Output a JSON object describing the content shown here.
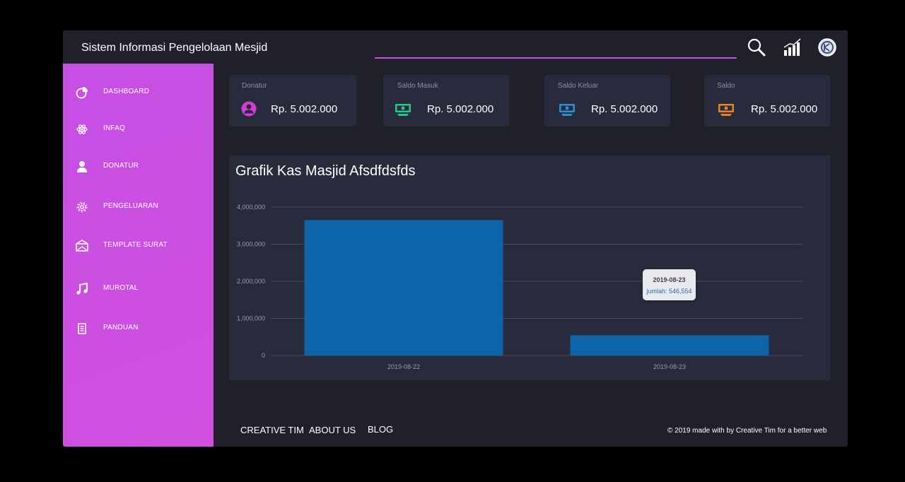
{
  "app": {
    "title": "Sistem Informasi Pengelolaan Mesjid"
  },
  "topbar": {
    "icons": [
      "search-icon",
      "chart-icon",
      "logo-icon"
    ]
  },
  "sidebar": {
    "items": [
      {
        "label": "DASHBOARD",
        "icon": "pie-chart-icon"
      },
      {
        "label": "INFAQ",
        "icon": "atom-icon"
      },
      {
        "label": "DONATUR",
        "icon": "user-icon"
      },
      {
        "label": "PENGELUARAN",
        "icon": "gear-icon"
      },
      {
        "label": "TEMPLATE SURAT",
        "icon": "mail-icon"
      },
      {
        "label": "MUROTAL",
        "icon": "music-icon"
      },
      {
        "label": "PANDUAN",
        "icon": "document-icon"
      }
    ]
  },
  "cards": [
    {
      "title": "Donatur",
      "value": "Rp. 5.002.000",
      "icon": "person-circle-icon",
      "color": "#d63bd2"
    },
    {
      "title": "Saldo Masuk",
      "value": "Rp. 5.002.000",
      "icon": "money-icon",
      "color": "#23c98e"
    },
    {
      "title": "Saldo Keluar",
      "value": "Rp. 5.002.000",
      "icon": "money-icon",
      "color": "#2b8fd6"
    },
    {
      "title": "Saldo",
      "value": "Rp. 5.002.000",
      "icon": "money-icon",
      "color": "#e8832a"
    }
  ],
  "chart": {
    "title": "Grafik Kas Masjid Afsdfdsfds",
    "bar_color": "#0d64a8",
    "tooltip": {
      "date": "2019-08-23",
      "text": "jumlah: 546,554"
    }
  },
  "chart_data": {
    "type": "bar",
    "categories": [
      "2019-08-22",
      "2019-08-23"
    ],
    "values": [
      3650000,
      546554
    ],
    "ylim": [
      0,
      4000000
    ],
    "yticks": [
      "0",
      "1,000,000",
      "2,000,000",
      "3,000,000",
      "4,000,000"
    ],
    "ytick_values": [
      0,
      1000000,
      2000000,
      3000000,
      4000000
    ],
    "grid": true
  },
  "footer": {
    "links": [
      "CREATIVE TIM",
      "ABOUT US",
      "BLOG"
    ],
    "copyright": "© 2019 made with  by Creative Tim for a better web"
  }
}
